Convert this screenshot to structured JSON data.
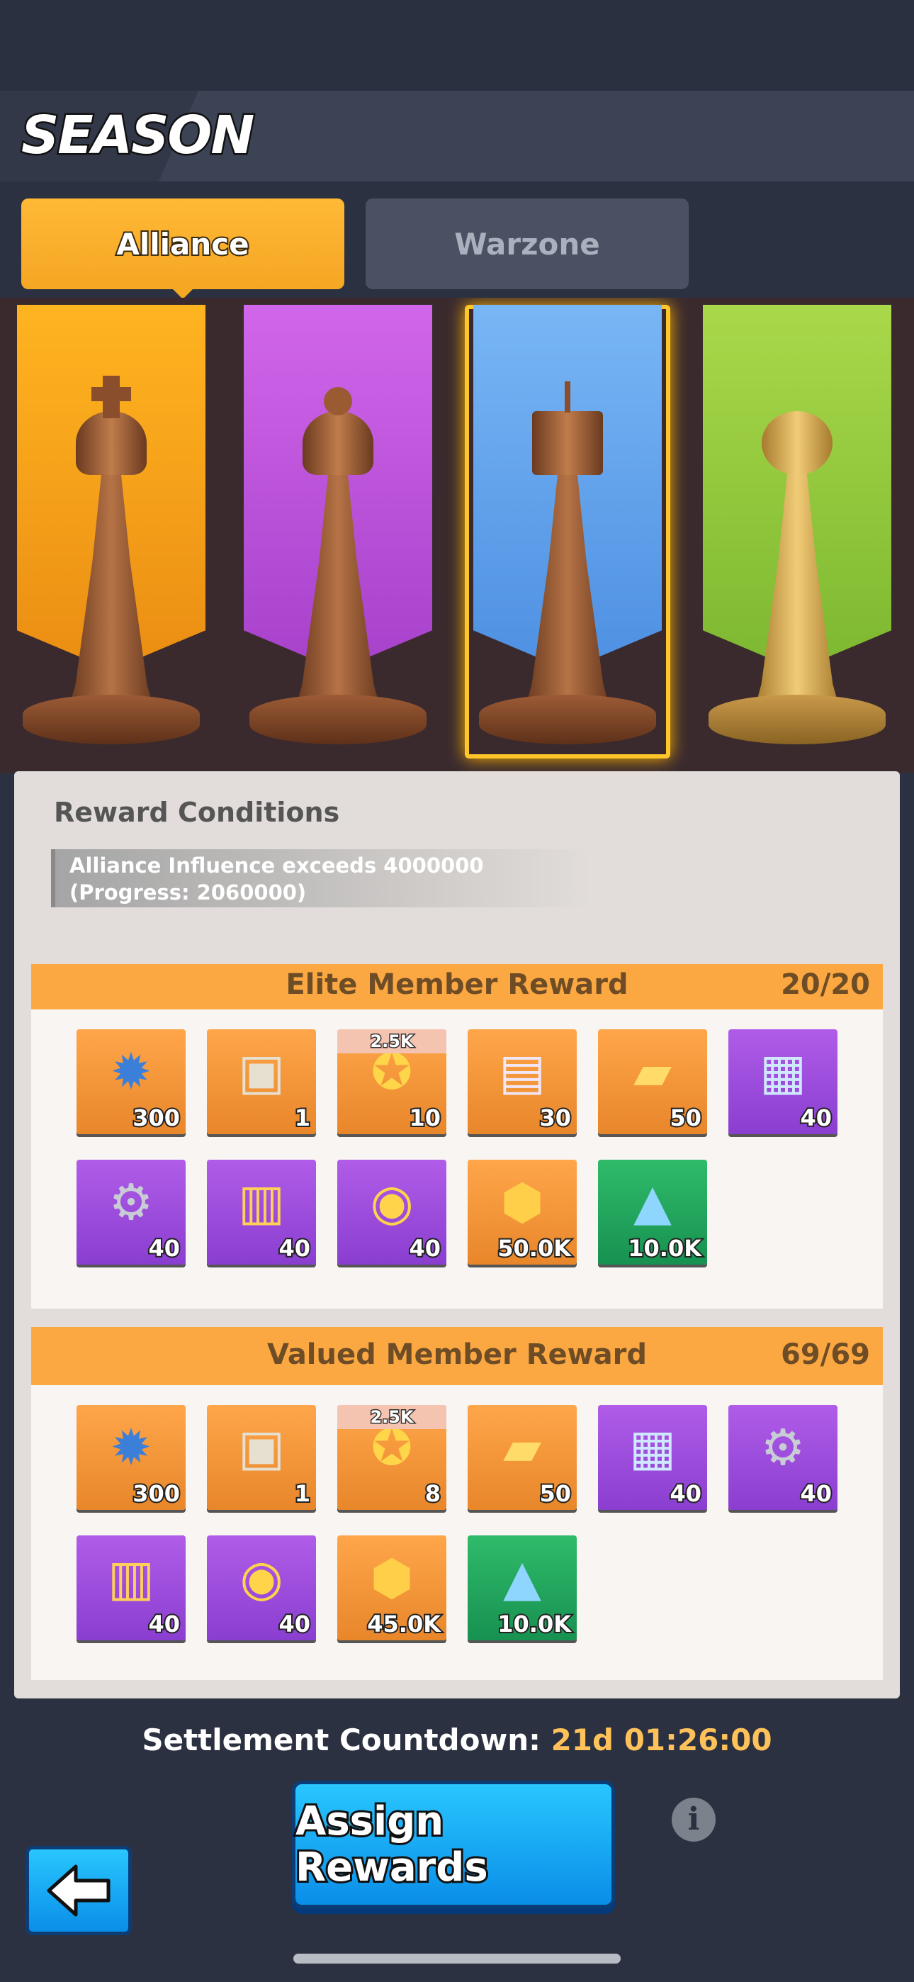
{
  "header": {
    "title": "SEASON"
  },
  "tabs": [
    {
      "label": "Alliance"
    },
    {
      "label": "Warzone"
    }
  ],
  "tiers": [
    "king-piece",
    "queen-piece",
    "rook-piece",
    "pawn-piece"
  ],
  "conditions": {
    "title": "Reward Conditions",
    "text": "Alliance Influence exceeds 4000000 (Progress: 2060000)"
  },
  "elite": {
    "title": "Elite Member Reward",
    "count": "20/20",
    "items": [
      {
        "icon": "star-badge-icon",
        "qty": "300",
        "color": "orange"
      },
      {
        "icon": "treasure-chest-icon",
        "qty": "1",
        "color": "orange"
      },
      {
        "icon": "medal-icon",
        "qty": "10",
        "tag": "2.5K",
        "color": "orange"
      },
      {
        "icon": "card-pack-icon",
        "qty": "30",
        "color": "orange"
      },
      {
        "icon": "gold-ticket-icon",
        "qty": "50",
        "color": "orange"
      },
      {
        "icon": "cash-crate-icon",
        "qty": "40",
        "color": "purple"
      },
      {
        "icon": "steel-crate-icon",
        "qty": "40",
        "color": "purple"
      },
      {
        "icon": "ammo-crate-icon",
        "qty": "40",
        "color": "purple"
      },
      {
        "icon": "coin-crate-icon",
        "qty": "40",
        "color": "purple"
      },
      {
        "icon": "honor-medal-icon",
        "qty": "50.0K",
        "color": "orange"
      },
      {
        "icon": "crystal-icon",
        "qty": "10.0K",
        "color": "green"
      }
    ]
  },
  "valued": {
    "title": "Valued Member Reward",
    "count": "69/69",
    "items": [
      {
        "icon": "star-badge-icon",
        "qty": "300",
        "color": "orange"
      },
      {
        "icon": "treasure-chest-icon",
        "qty": "1",
        "color": "orange"
      },
      {
        "icon": "medal-icon",
        "qty": "8",
        "tag": "2.5K",
        "color": "orange"
      },
      {
        "icon": "gold-ticket-icon",
        "qty": "50",
        "color": "orange"
      },
      {
        "icon": "cash-crate-icon",
        "qty": "40",
        "color": "purple"
      },
      {
        "icon": "steel-crate-icon",
        "qty": "40",
        "color": "purple"
      },
      {
        "icon": "ammo-crate-icon",
        "qty": "40",
        "color": "purple"
      },
      {
        "icon": "coin-crate-icon",
        "qty": "40",
        "color": "purple"
      },
      {
        "icon": "honor-medal-icon",
        "qty": "45.0K",
        "color": "orange"
      },
      {
        "icon": "crystal-icon",
        "qty": "10.0K",
        "color": "green"
      }
    ]
  },
  "countdown": {
    "label": "Settlement Countdown:",
    "time": "21d 01:26:00"
  },
  "buttons": {
    "assign": "Assign Rewards",
    "info": "i"
  },
  "colors": {
    "accent": "#f5a623",
    "button": "#0a8ee8",
    "countdown_time": "#ffc25a"
  }
}
